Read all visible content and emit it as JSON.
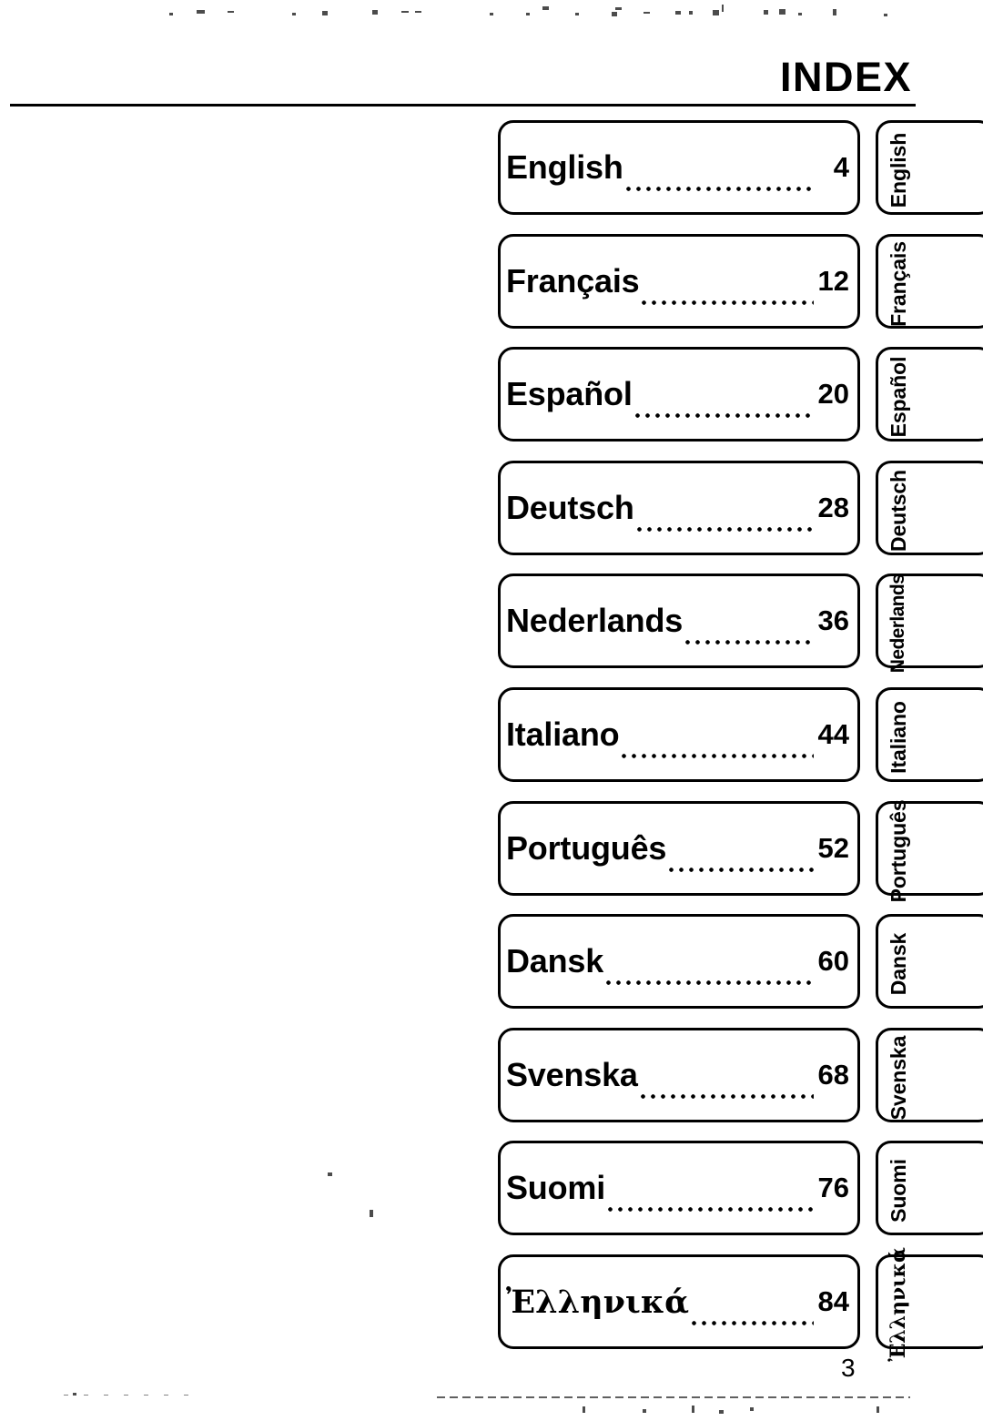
{
  "document": {
    "title": "INDEX",
    "page_number": "3"
  },
  "languages": [
    {
      "name": "English",
      "page": "4",
      "tab": "English"
    },
    {
      "name": "Français",
      "page": "12",
      "tab": "Français"
    },
    {
      "name": "Español",
      "page": "20",
      "tab": "Español"
    },
    {
      "name": "Deutsch",
      "page": "28",
      "tab": "Deutsch"
    },
    {
      "name": "Nederlands",
      "page": "36",
      "tab": "Nederlands"
    },
    {
      "name": "Italiano",
      "page": "44",
      "tab": "Italiano"
    },
    {
      "name": "Português",
      "page": "52",
      "tab": "Português"
    },
    {
      "name": "Dansk",
      "page": "60",
      "tab": "Dansk"
    },
    {
      "name": "Svenska",
      "page": "68",
      "tab": "Svenska"
    },
    {
      "name": "Suomi",
      "page": "76",
      "tab": "Suomi"
    },
    {
      "name": "Ἐλληνικά",
      "page": "84",
      "tab": "Ἐλληνικά"
    }
  ],
  "colors": {
    "ink": "#000000",
    "paper": "#ffffff"
  }
}
